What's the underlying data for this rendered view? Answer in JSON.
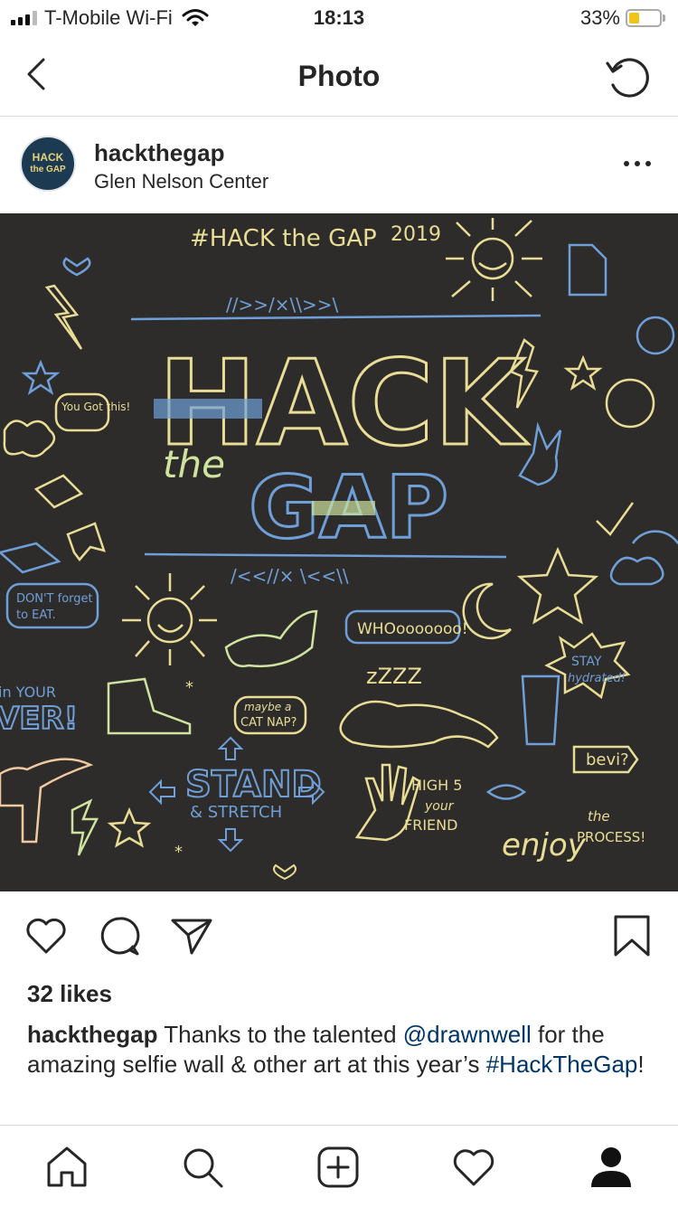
{
  "status": {
    "carrier": "T-Mobile Wi-Fi",
    "time": "18:13",
    "battery_percent": "33%",
    "battery_level": 0.33,
    "battery_color": "#f2c418"
  },
  "nav": {
    "title": "Photo",
    "back_icon": "chevron-left-icon",
    "refresh_icon": "refresh-icon"
  },
  "post": {
    "avatar_text_1": "HACK",
    "avatar_text_2": "the GAP",
    "username": "hackthegap",
    "location": "Glen Nelson Center",
    "more_icon": "more-horizontal-icon",
    "photo": {
      "hashtag": "#HACK the GAP",
      "year": "2019",
      "word_hack": "HACK",
      "word_the": "the",
      "word_gap": "GAP",
      "you_got_this": "You Got this!",
      "dont_forget": "DON'T forget",
      "to_eat": "to EAT.",
      "whoo": "WHOooooooo!",
      "stay": "STAY",
      "hydrated": "hydrated!",
      "maybe": "maybe a",
      "cat_nap": "CAT NAP?",
      "zzz": "zZZZ",
      "in_your": "in YOUR",
      "ver": "VER!",
      "stand": "STAND",
      "stretch": "& STRETCH",
      "high5": "HIGH 5",
      "your": "your",
      "friend": "FRIEND",
      "bevi": "bevi?",
      "enjoy": "enjoy",
      "the_small": "the",
      "process": "PROCESS!"
    },
    "likes": "32 likes",
    "caption": {
      "user": "hackthegap",
      "text1": " Thanks to the talented ",
      "mention": "@drawnwell",
      "text2": " for the amazing selfie wall & other art at this year’s ",
      "hashtag": "#HackTheGap",
      "text3": "!"
    }
  },
  "colors": {
    "chalk_yellow": "#e9dd96",
    "chalk_blue": "#6f9fd8",
    "chalk_peach": "#f0c9a0",
    "chalk_green": "#cfe3a0",
    "board": "#2e2c2a",
    "link": "#003569"
  }
}
